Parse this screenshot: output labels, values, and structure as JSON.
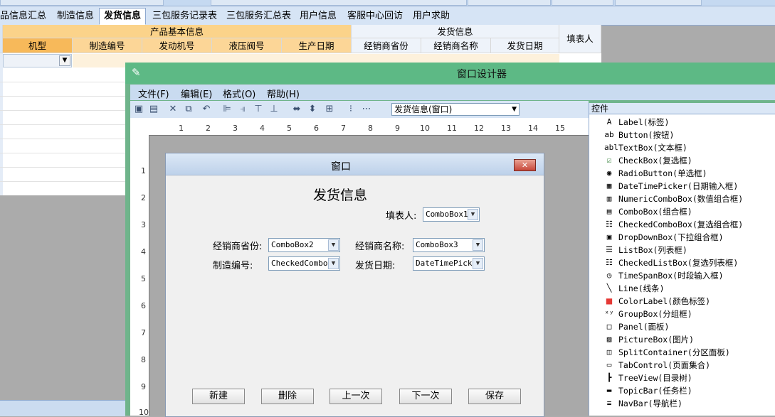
{
  "top_tabs": [
    "品信息汇总",
    "制造信息",
    "发货信息",
    "三包服务记录表",
    "三包服务汇总表",
    "用户信息",
    "客服中心回访",
    "用户求助"
  ],
  "sheet": {
    "group_product": "产品基本信息",
    "group_ship": "发货信息",
    "filler": "填表人",
    "columns": [
      "机型",
      "制造编号",
      "发动机号",
      "液压阀号",
      "生产日期",
      "经销商省份",
      "经销商名称",
      "发货日期"
    ]
  },
  "designer": {
    "title": "窗口设计器",
    "menus": [
      "文件(F)",
      "编辑(E)",
      "格式(O)",
      "帮助(H)"
    ],
    "selector": "发货信息(窗口)",
    "ruler_h": [
      "1",
      "2",
      "3",
      "4",
      "5",
      "6",
      "7",
      "8",
      "9",
      "10",
      "11",
      "12",
      "13",
      "14",
      "15"
    ],
    "ruler_v": [
      "1",
      "2",
      "3",
      "4",
      "5",
      "6",
      "7",
      "8",
      "9",
      "10"
    ]
  },
  "form": {
    "window_title": "窗口",
    "heading": "发货信息",
    "filler_label": "填表人:",
    "filler_value": "ComboBox1",
    "province_label": "经销商省份:",
    "province_value": "ComboBox2",
    "dealer_label": "经销商名称:",
    "dealer_value": "ComboBox3",
    "serial_label": "制造编号:",
    "serial_value": "CheckedComboB",
    "date_label": "发货日期:",
    "date_value": "DateTimePicke",
    "buttons": [
      "新建",
      "删除",
      "上一次",
      "下一次",
      "保存"
    ]
  },
  "toolbox": {
    "header": "控件",
    "items": [
      {
        "name": "Label(标签)",
        "icon": "label-icon"
      },
      {
        "name": "Button(按钮)",
        "icon": "button-icon"
      },
      {
        "name": "TextBox(文本框)",
        "icon": "textbox-icon"
      },
      {
        "name": "CheckBox(复选框)",
        "icon": "checkbox-icon"
      },
      {
        "name": "RadioButton(单选框)",
        "icon": "radio-icon"
      },
      {
        "name": "DateTimePicker(日期输入框)",
        "icon": "calendar-icon"
      },
      {
        "name": "NumericComboBox(数值组合框)",
        "icon": "numeric-combo-icon"
      },
      {
        "name": "ComboBox(组合框)",
        "icon": "combobox-icon"
      },
      {
        "name": "CheckedComboBox(复选组合框)",
        "icon": "checked-combo-icon"
      },
      {
        "name": "DropDownBox(下拉组合框)",
        "icon": "dropdown-icon"
      },
      {
        "name": "ListBox(列表框)",
        "icon": "listbox-icon"
      },
      {
        "name": "CheckedListBox(复选列表框)",
        "icon": "checked-list-icon"
      },
      {
        "name": "TimeSpanBox(时段输入框)",
        "icon": "clock-icon"
      },
      {
        "name": "Line(线条)",
        "icon": "line-icon"
      },
      {
        "name": "ColorLabel(颜色标签)",
        "icon": "color-label-icon"
      },
      {
        "name": "GroupBox(分组框)",
        "icon": "groupbox-icon"
      },
      {
        "name": "Panel(面板)",
        "icon": "panel-icon"
      },
      {
        "name": "PictureBox(图片)",
        "icon": "picture-icon"
      },
      {
        "name": "SplitContainer(分区面板)",
        "icon": "split-icon"
      },
      {
        "name": "TabControl(页面集合)",
        "icon": "tab-icon"
      },
      {
        "name": "TreeView(目录树)",
        "icon": "tree-icon"
      },
      {
        "name": "TopicBar(任务栏)",
        "icon": "topicbar-icon"
      },
      {
        "name": "NavBar(导航栏)",
        "icon": "navbar-icon"
      }
    ]
  }
}
